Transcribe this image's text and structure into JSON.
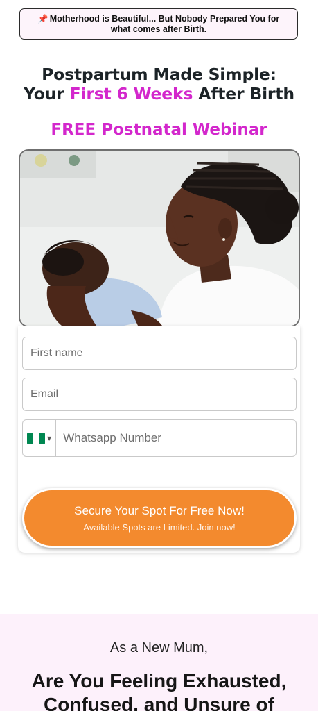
{
  "banner": {
    "icon": "pushpin-icon",
    "text": "Motherhood is Beautiful... But Nobody Prepared You for what comes after Birth."
  },
  "headline": {
    "line1": "Postpartum Made Simple:",
    "line2_before": "Your ",
    "line2_accent": "First 6 Weeks",
    "line2_after": " After Birth"
  },
  "subheadline": "FREE Postnatal Webinar",
  "hero_image": {
    "subject": "mother-holding-newborn-photo"
  },
  "form": {
    "first_name_placeholder": "First name",
    "email_placeholder": "Email",
    "phone_placeholder": "Whatsapp Number",
    "country_flag": "nigeria-flag-icon",
    "submit": {
      "label": "Secure Your Spot For Free Now!",
      "sublabel": "Available Spots are Limited. Join now!"
    }
  },
  "section2": {
    "lead": "As a New Mum,",
    "question": "Are You Feeling Exhausted, Confused, and Unsure of"
  },
  "colors": {
    "accent_magenta": "#d327cc",
    "cta_orange": "#f38a2e",
    "section_bg": "#fdf1fb",
    "flag_green": "#008751"
  }
}
